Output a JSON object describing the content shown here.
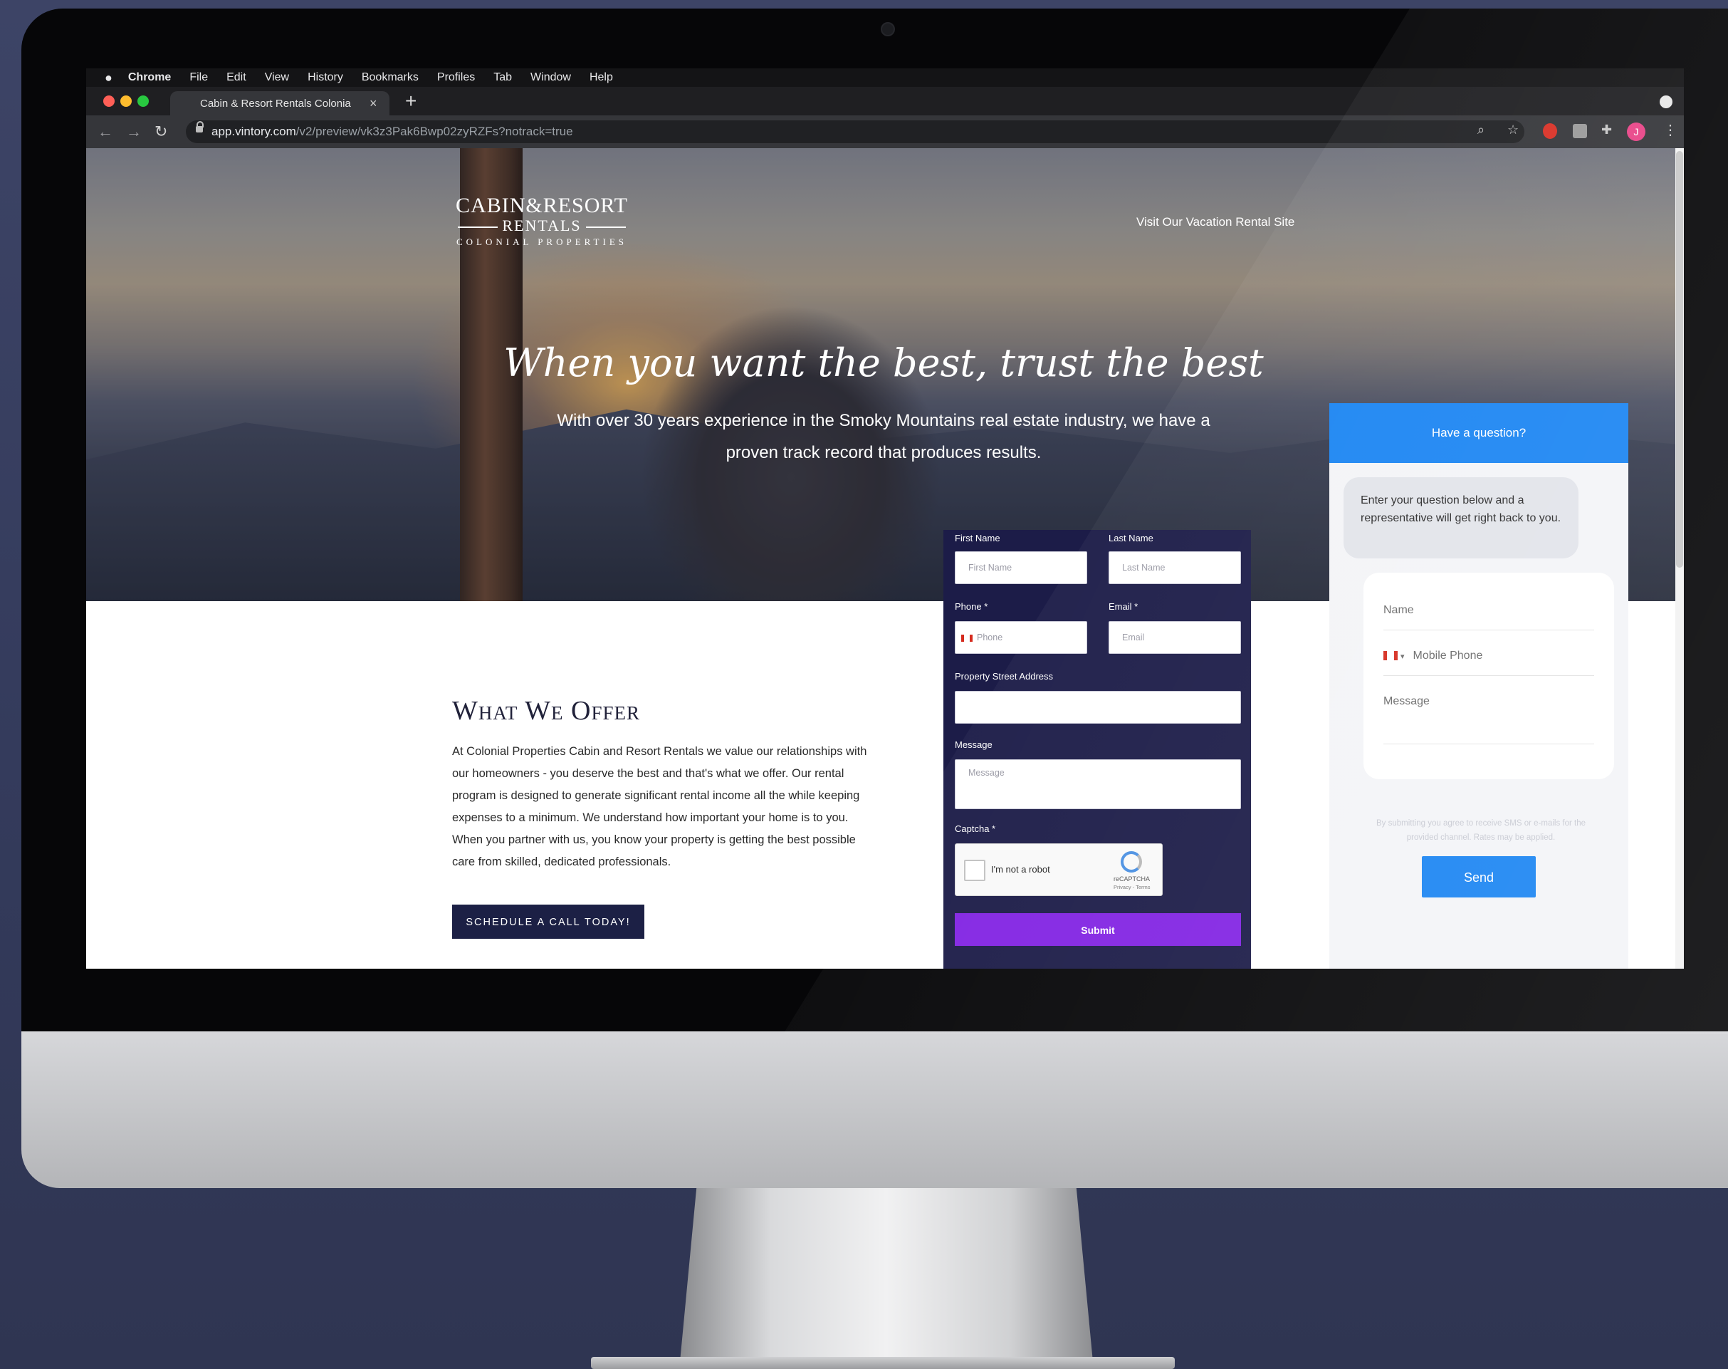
{
  "menubar": {
    "apple": "",
    "app": "Chrome",
    "items": [
      "File",
      "Edit",
      "View",
      "History",
      "Bookmarks",
      "Profiles",
      "Tab",
      "Window",
      "Help"
    ]
  },
  "browser": {
    "tab_title": "Cabin & Resort Rentals Colonia",
    "tab_close": "×",
    "new_tab": "+",
    "url_host": "app.vintory.com",
    "url_path": "/v2/preview/vk3z3Pak6Bwp02zyRZFs?notrack=true",
    "profile_initial": "J"
  },
  "site": {
    "logo_line1": "CABIN&RESORT",
    "logo_line2": "RENTALS",
    "logo_line3": "COLONIAL PROPERTIES",
    "visit_link": "Visit Our Vacation Rental Site",
    "tagline": "When you want the best, trust the best",
    "subtagline": "With over 30 years experience in the Smoky Mountains real estate industry, we have a proven track record that produces results.",
    "offer_title": "What We Offer",
    "offer_body": "At Colonial Properties Cabin and Resort Rentals we value our relationships with our homeowners - you deserve the best and that's what we offer. Our rental program is designed to generate significant rental income all the while keeping expenses to a minimum. We understand how important your home is to you. When you partner with us, you know your property is getting the best possible care from skilled, dedicated professionals.",
    "schedule_button": "SCHEDULE A CALL TODAY!"
  },
  "form": {
    "first_name_label": "First Name",
    "first_name_placeholder": "First Name",
    "last_name_label": "Last Name",
    "last_name_placeholder": "Last Name",
    "phone_label": "Phone *",
    "phone_placeholder": "Phone",
    "email_label": "Email *",
    "email_placeholder": "Email",
    "address_label": "Property Street Address",
    "address_value": "",
    "message_label": "Message",
    "message_placeholder": "Message",
    "captcha_label": "Captcha *",
    "captcha_text": "I'm not a robot",
    "captcha_brand": "reCAPTCHA",
    "captcha_links": "Privacy - Terms",
    "submit": "Submit"
  },
  "chat": {
    "header": "Have a question?",
    "bubble": "Enter your question below and a representative will get right back to you.",
    "name_placeholder": "Name",
    "phone_placeholder": "Mobile Phone",
    "message_placeholder": "Message",
    "legal": "By submitting you agree to receive SMS or e-mails for the provided channel. Rates may be applied.",
    "send": "Send"
  },
  "colors": {
    "form_bg": "#1c1c48",
    "submit_bg": "#8224e3",
    "chat_accent": "#1b85f2",
    "schedule_bg": "#1c2045"
  }
}
